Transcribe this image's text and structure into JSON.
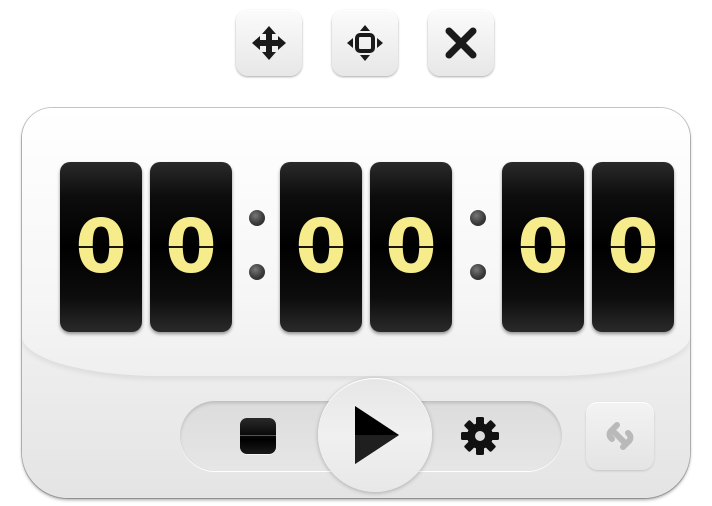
{
  "toolbar": {
    "move_icon": "move-arrows-icon",
    "resize_icon": "resize-icon",
    "close_icon": "close-icon"
  },
  "timer": {
    "hours_tens": "0",
    "hours_ones": "0",
    "minutes_tens": "0",
    "minutes_ones": "0",
    "seconds_tens": "0",
    "seconds_ones": "0",
    "digit_color": "#f7ec8c"
  },
  "controls": {
    "stop_icon": "stop-icon",
    "play_icon": "play-icon",
    "settings_icon": "gear-icon",
    "link_icon": "chain-link-icon"
  }
}
